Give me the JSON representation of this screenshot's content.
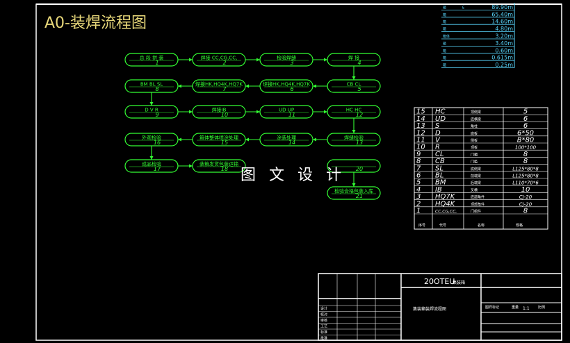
{
  "title": "A0-装焊流程图",
  "watermark": "图 文 设 计",
  "colors": {
    "bg": "#000000",
    "frame": "#ffffff",
    "flow": "#33ff33",
    "title": "#e8d87a",
    "cyan": "#5ad8ff"
  },
  "flow_nodes": [
    {
      "id": "1",
      "label": "总 段 拼 装"
    },
    {
      "id": "2",
      "label": "焊接 CC,CG,CC,"
    },
    {
      "id": "3",
      "label": "检验焊缝"
    },
    {
      "id": "4",
      "label": "焊   接"
    },
    {
      "id": "5",
      "label": "CB   CL"
    },
    {
      "id": "6",
      "label": "焊接HK,HQ4K,HQ7K"
    },
    {
      "id": "7",
      "label": "焊接HK,HQ4K,HQ7K"
    },
    {
      "id": "8",
      "label": "BM  BL  SL"
    },
    {
      "id": "9",
      "label": "D  V  R"
    },
    {
      "id": "10",
      "label": "焊接IB"
    },
    {
      "id": "11",
      "label": "UD  UP"
    },
    {
      "id": "12",
      "label": "HC HC"
    },
    {
      "id": "13",
      "label": "焊缝检验"
    },
    {
      "id": "14",
      "label": "涂装处理"
    },
    {
      "id": "15",
      "label": "箱体整体喷涂处理"
    },
    {
      "id": "16",
      "label": "外观检验"
    },
    {
      "id": "17",
      "label": "成品检验"
    },
    {
      "id": "18",
      "label": "装箱发货包装运输"
    },
    {
      "id": "20",
      "label": ""
    },
    {
      "id": "21",
      "label": "检验合格包装入库"
    }
  ],
  "top_table": [
    {
      "code": "箱",
      "sym": "E",
      "len": "89.90m"
    },
    {
      "code": "箱",
      "sym": "",
      "len": "65.40m"
    },
    {
      "code": "箱",
      "sym": "",
      "len": "14.60m"
    },
    {
      "code": "箱",
      "sym": "",
      "len": "4.80m"
    },
    {
      "code": "箱体",
      "sym": "",
      "len": "3.20m"
    },
    {
      "code": "箱",
      "sym": "",
      "len": "3.40m"
    },
    {
      "code": "箱",
      "sym": "",
      "len": "0.60m"
    },
    {
      "code": "箱",
      "sym": "",
      "len": "0.615m"
    },
    {
      "code": "箱",
      "sym": "",
      "len": "0.25m"
    }
  ],
  "parts_table": {
    "rows": [
      {
        "no": "15",
        "code": "HC",
        "name": "顶侧梁",
        "spec": "5"
      },
      {
        "no": "14",
        "code": "UD",
        "name": "底横梁",
        "spec": "6"
      },
      {
        "no": "13",
        "code": "S",
        "name": "角柱",
        "spec": "6"
      },
      {
        "no": "12",
        "code": "D",
        "name": "底板",
        "spec": "6*50"
      },
      {
        "no": "11",
        "code": "V",
        "name": "侧板",
        "spec": "B*80"
      },
      {
        "no": "10",
        "code": "R",
        "name": "顶板",
        "spec": "100*100"
      },
      {
        "no": "9",
        "code": "CL",
        "name": "门楣",
        "spec": "8"
      },
      {
        "no": "8",
        "code": "CB",
        "name": "门槛",
        "spec": "8"
      },
      {
        "no": "7",
        "code": "SL",
        "name": "底侧梁",
        "spec": "L125*80*8"
      },
      {
        "no": "6",
        "code": "BL",
        "name": "前端梁",
        "spec": "L125*80*8"
      },
      {
        "no": "5",
        "code": "BM",
        "name": "后端梁",
        "spec": "L110*70*6"
      },
      {
        "no": "4",
        "code": "IB",
        "name": "叉槽",
        "spec": "10"
      },
      {
        "no": "3",
        "code": "HQ7K",
        "name": "底部角件",
        "spec": "CJ-20"
      },
      {
        "no": "2",
        "code": "HQ4K",
        "name": "顶部角件",
        "spec": "CJ-20"
      },
      {
        "no": "1",
        "code": "CC,CG,CC,",
        "name": "门组件",
        "spec": "8"
      }
    ],
    "header": {
      "no": "序号",
      "code": "代号",
      "name": "名称",
      "spec": "规格"
    }
  },
  "title_block": {
    "model": "20OTEU",
    "model_suffix": "集装箱",
    "drawing_name": "集装箱装焊流程图",
    "labels": [
      "设计",
      "校对",
      "审核",
      "工艺",
      "标准",
      "批准"
    ],
    "right_labels": [
      "图样标记",
      "重量",
      "比例"
    ],
    "scale": "1:1"
  }
}
